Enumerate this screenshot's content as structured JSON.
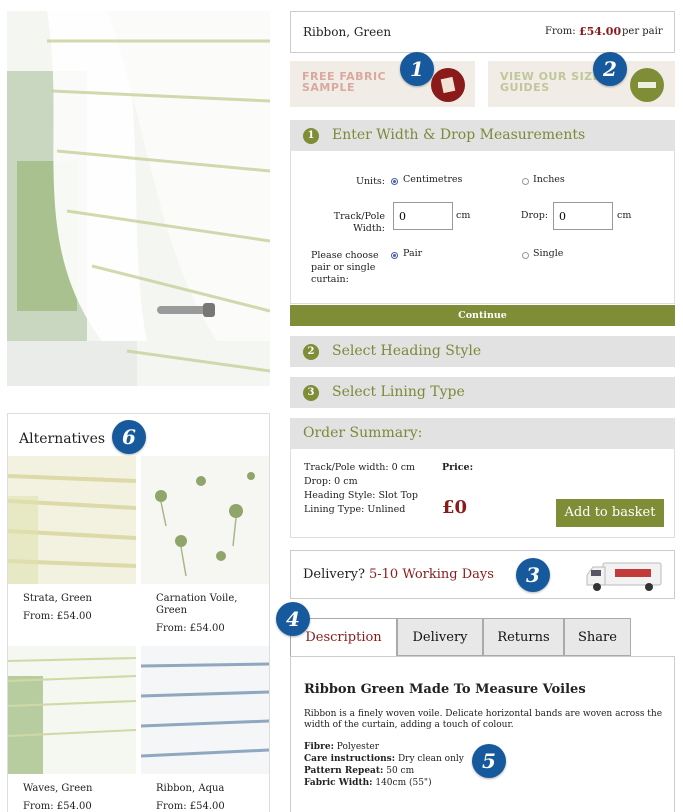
{
  "product": {
    "name": "Ribbon, Green",
    "from_label": "From:",
    "price": "£54.00",
    "per": "per pair"
  },
  "promos": {
    "fabric_sample": "Free fabric sample",
    "size_guides": "View our size guides"
  },
  "badges": [
    "1",
    "2",
    "3",
    "4",
    "5",
    "6"
  ],
  "steps": {
    "step1": {
      "num": "1",
      "label": "Enter Width & Drop Measurements"
    },
    "step2": {
      "num": "2",
      "label": "Select Heading Style"
    },
    "step3": {
      "num": "3",
      "label": "Select Lining Type"
    }
  },
  "measure_form": {
    "units_label": "Units:",
    "unit_cm": "Centimetres",
    "unit_in": "Inches",
    "width_label": "Track/Pole Width:",
    "width_value": "0",
    "width_unit": "cm",
    "drop_label": "Drop:",
    "drop_value": "0",
    "drop_unit": "cm",
    "pair_label": "Please choose pair or single curtain:",
    "opt_pair": "Pair",
    "opt_single": "Single",
    "selected_units": "Centimetres",
    "selected_type": "Pair"
  },
  "continue_label": "Continue",
  "summary": {
    "title": "Order Summary:",
    "lines": [
      "Track/Pole width: 0 cm",
      "Drop: 0 cm",
      "Heading Style: Slot Top",
      "Lining Type: Unlined"
    ],
    "price_label": "Price:",
    "price_value": "£0",
    "basket_label": "Add to basket"
  },
  "delivery": {
    "question": "Delivery?",
    "days": "5-10 Working Days"
  },
  "tabs": [
    "Description",
    "Delivery",
    "Returns",
    "Share"
  ],
  "description": {
    "title": "Ribbon Green Made To Measure Voiles",
    "body": "Ribbon is a finely woven voile. Delicate horizontal bands are woven across the width of the curtain, adding a touch of colour.",
    "specs": [
      {
        "key": "Fibre:",
        "value": "Polyester"
      },
      {
        "key": "Care instructions:",
        "value": "Dry clean only"
      },
      {
        "key": "Pattern Repeat:",
        "value": "50 cm"
      },
      {
        "key": "Fabric Width:",
        "value": "140cm (55\")"
      }
    ]
  },
  "alternatives": {
    "title": "Alternatives",
    "items": [
      {
        "name": "Strata, Green",
        "price": "From: £54.00"
      },
      {
        "name": "Carnation Voile, Green",
        "price": "From: £54.00"
      },
      {
        "name": "Waves, Green",
        "price": "From: £54.00"
      },
      {
        "name": "Ribbon, Aqua",
        "price": "From: £54.00"
      }
    ]
  },
  "colors": {
    "accent_green": "#7f8d37",
    "price_red": "#8b1a1a",
    "badge_blue": "#16599c"
  }
}
